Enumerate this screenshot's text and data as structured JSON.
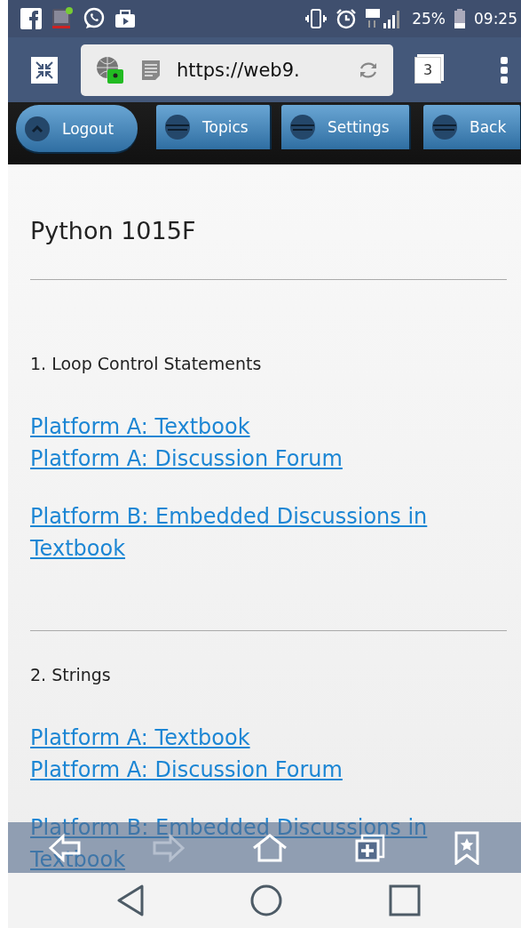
{
  "status_bar": {
    "battery": "25%",
    "time": "09:25"
  },
  "browser_bar": {
    "url": "https://web9.",
    "tab_count": "3"
  },
  "nav_buttons": [
    {
      "label": "Logout",
      "kind": "pill"
    },
    {
      "label": "Topics",
      "kind": "tab"
    },
    {
      "label": "Settings",
      "kind": "tab"
    },
    {
      "label": "Back",
      "kind": "tab"
    }
  ],
  "page": {
    "title": "Python 1015F",
    "sections": [
      {
        "heading": "1. Loop Control Statements",
        "link_groups": [
          [
            "Platform A: Textbook",
            "Platform A: Discussion Forum"
          ],
          [
            "Platform B: Embedded Discussions in Textbook"
          ]
        ]
      },
      {
        "heading": "2. Strings",
        "link_groups": [
          [
            "Platform A: Textbook",
            "Platform A: Discussion Forum"
          ],
          [
            "Platform B: Embedded Discussions in Textbook"
          ]
        ]
      }
    ]
  },
  "bottom_toolbar": [
    {
      "kind": "back",
      "disabled": false
    },
    {
      "kind": "forward",
      "disabled": true
    },
    {
      "kind": "home",
      "disabled": false
    },
    {
      "kind": "tabs",
      "disabled": false
    },
    {
      "kind": "bookmark",
      "disabled": false
    }
  ]
}
